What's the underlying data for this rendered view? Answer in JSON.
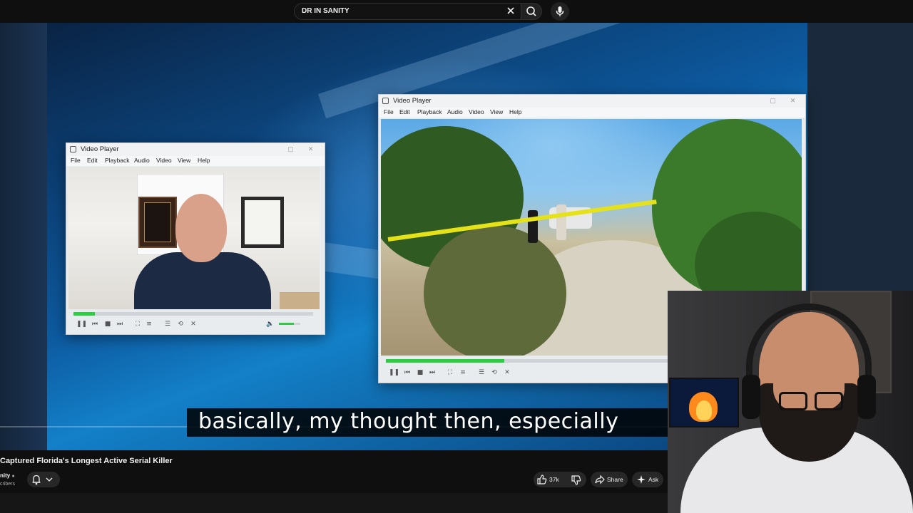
{
  "search": {
    "query": "DR IN SANITY"
  },
  "players": {
    "left": {
      "title": "Video Player",
      "menu": [
        "File",
        "Edit",
        "Playback",
        "Audio",
        "Video",
        "View",
        "Help"
      ],
      "progress": 0.09,
      "volume": 0.7
    },
    "right": {
      "title": "Video Player",
      "menu": [
        "File",
        "Edit",
        "Playback",
        "Audio",
        "Video",
        "View",
        "Help"
      ],
      "progress": 0.42
    }
  },
  "caption": {
    "text": "basically, my thought then, especially"
  },
  "video": {
    "title": "Captured Florida's Longest Active Serial Killer",
    "channel_fragment": "nity",
    "subscribers_fragment": "cribers",
    "likes": "37k",
    "share_label": "Share",
    "ask_label": "Ask"
  },
  "colors": {
    "progress_green": "#2ecc40",
    "caution_tape": "#e6e21a",
    "page_bg": "#0f0f0f"
  }
}
